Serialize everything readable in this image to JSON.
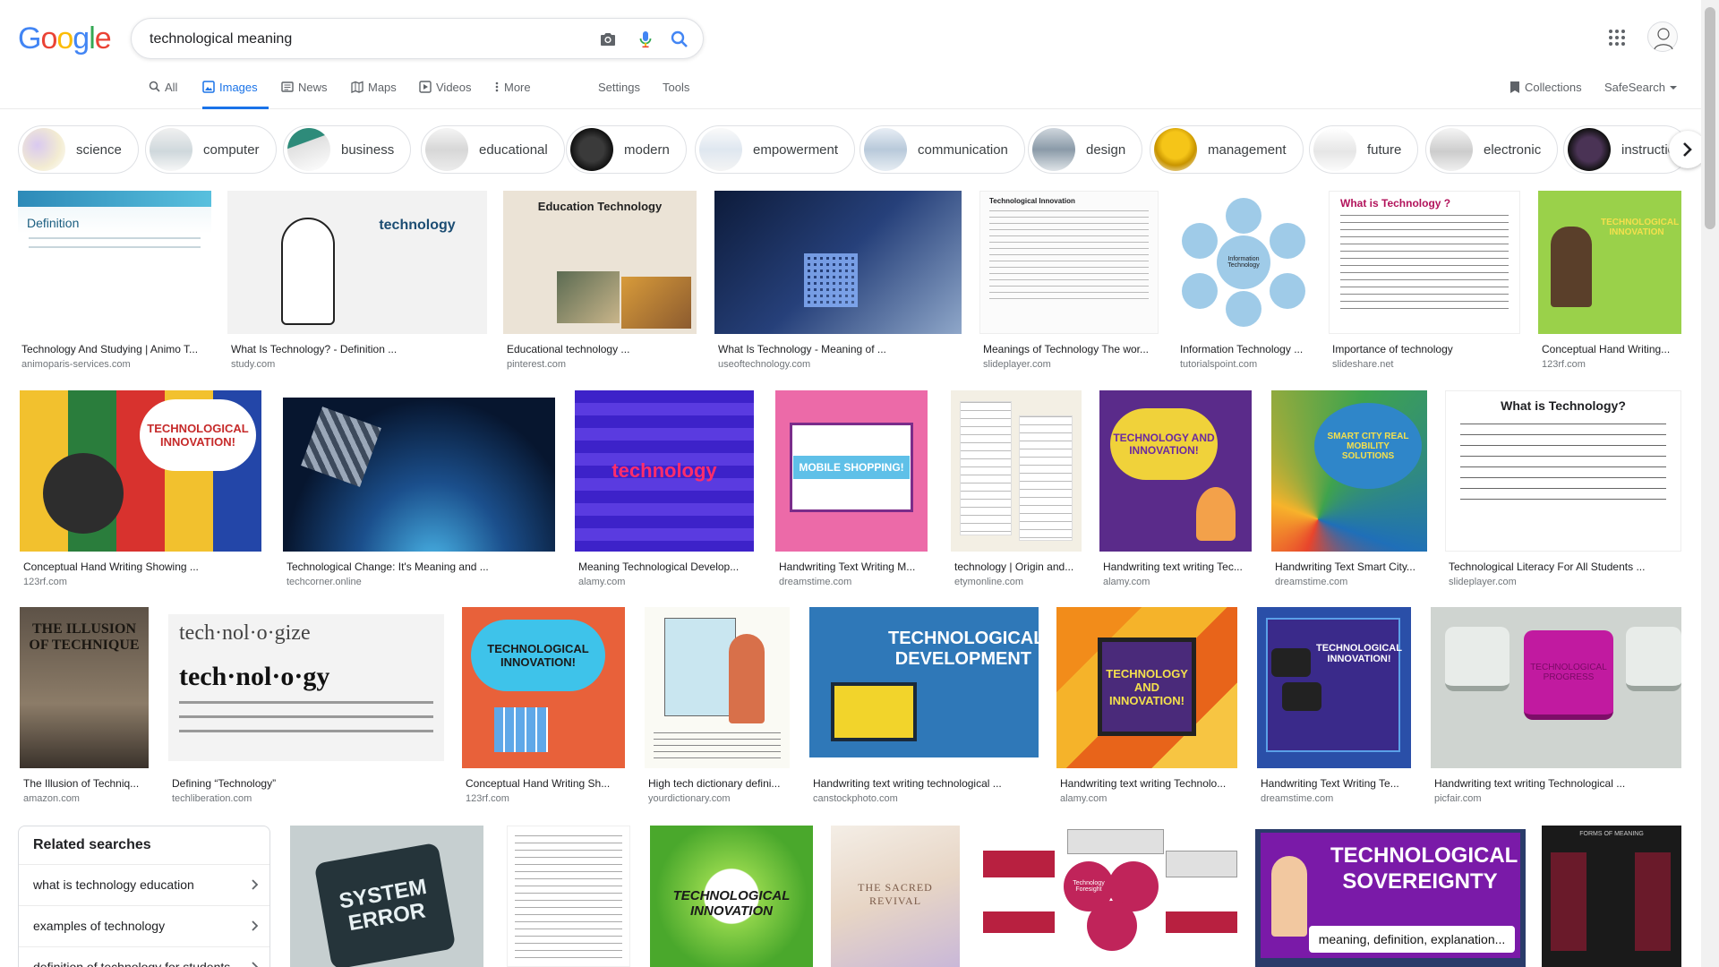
{
  "header": {
    "logo_letters": [
      {
        "ch": "G",
        "color": "#4285F4"
      },
      {
        "ch": "o",
        "color": "#EA4335"
      },
      {
        "ch": "o",
        "color": "#FBBC05"
      },
      {
        "ch": "g",
        "color": "#4285F4"
      },
      {
        "ch": "l",
        "color": "#34A853"
      },
      {
        "ch": "e",
        "color": "#EA4335"
      }
    ],
    "search_value": "technological meaning"
  },
  "nav": {
    "all": "All",
    "images": "Images",
    "news": "News",
    "maps": "Maps",
    "videos": "Videos",
    "more": "More",
    "settings": "Settings",
    "tools": "Tools",
    "collections": "Collections",
    "safesearch": "SafeSearch"
  },
  "chips": [
    "science",
    "computer",
    "business",
    "educational",
    "modern",
    "empowerment",
    "communication",
    "design",
    "management",
    "future",
    "electronic",
    "instructio"
  ],
  "results": [
    {
      "caption": "Technology And Studying | Animo T...",
      "source": "animoparis-services.com",
      "art": "Definition"
    },
    {
      "caption": "What Is Technology? - Definition ...",
      "source": "study.com",
      "art": "technology"
    },
    {
      "caption": "Educational technology ...",
      "source": "pinterest.com",
      "art": "Education Technology"
    },
    {
      "caption": "What Is Technology - Meaning of ...",
      "source": "useoftechnology.com",
      "art": ""
    },
    {
      "caption": "Meanings of Technology The wor...",
      "source": "slideplayer.com",
      "art": "Technological Innovation"
    },
    {
      "caption": "Information Technology ...",
      "source": "tutorialspoint.com",
      "art": "Information Technology"
    },
    {
      "caption": "Importance of technology",
      "source": "slideshare.net",
      "art": "What is Technology ?"
    },
    {
      "caption": "Conceptual Hand Writing...",
      "source": "123rf.com",
      "art": "TECHNOLOGICAL INNOVATION"
    },
    {
      "caption": "Conceptual Hand Writing Showing ...",
      "source": "123rf.com",
      "art": "TECHNOLOGICAL INNOVATION!"
    },
    {
      "caption": "Technological Change: It's Meaning and ...",
      "source": "techcorner.online",
      "art": ""
    },
    {
      "caption": "Meaning Technological Develop...",
      "source": "alamy.com",
      "art": "technology"
    },
    {
      "caption": "Handwriting Text Writing M...",
      "source": "dreamstime.com",
      "art": "MOBILE SHOPPING!"
    },
    {
      "caption": "technology | Origin and...",
      "source": "etymonline.com",
      "art": ""
    },
    {
      "caption": "Handwriting text writing Tec...",
      "source": "alamy.com",
      "art": "TECHNOLOGY AND INNOVATION!"
    },
    {
      "caption": "Handwriting Text Smart City...",
      "source": "dreamstime.com",
      "art": "SMART CITY REAL MOBILITY SOLUTIONS"
    },
    {
      "caption": "Technological Literacy For All Students ...",
      "source": "slideplayer.com",
      "art": "What is Technology?"
    },
    {
      "caption": "The Illusion of Techniq...",
      "source": "amazon.com",
      "art": "THE ILLUSION OF TECHNIQUE"
    },
    {
      "caption": "Defining “Technology”",
      "source": "techliberation.com",
      "art": "tech·nol·o·gy"
    },
    {
      "caption": "Conceptual Hand Writing Sh...",
      "source": "123rf.com",
      "art": "TECHNOLOGICAL INNOVATION!"
    },
    {
      "caption": "High tech dictionary defini...",
      "source": "yourdictionary.com",
      "art": ""
    },
    {
      "caption": "Handwriting text writing technological ...",
      "source": "canstockphoto.com",
      "art": "TECHNOLOGICAL DEVELOPMENT"
    },
    {
      "caption": "Handwriting text writing Technolo...",
      "source": "alamy.com",
      "art": "TECHNOLOGY AND INNOVATION!"
    },
    {
      "caption": "Handwriting Text Writing Te...",
      "source": "dreamstime.com",
      "art": "TECHNOLOGICAL INNOVATION!"
    },
    {
      "caption": "Handwriting text writing Technological ...",
      "source": "picfair.com",
      "art": "TECHNOLOGICAL PROGRESS"
    }
  ],
  "bottom_row": [
    {
      "art": "SYSTEM ERROR"
    },
    {
      "art": ""
    },
    {
      "art": "TECHNOLOGICAL INNOVATION"
    },
    {
      "art": "THE SACRED REVIVAL"
    },
    {
      "art": "Technology Foresight"
    },
    {
      "art": "TECHNOLOGICAL SOVEREIGNTY"
    },
    {
      "art": "FORMS OF MEANING"
    }
  ],
  "related": {
    "title": "Related searches",
    "items": [
      "what is technology education",
      "examples of technology",
      "definition of technology for students"
    ]
  }
}
